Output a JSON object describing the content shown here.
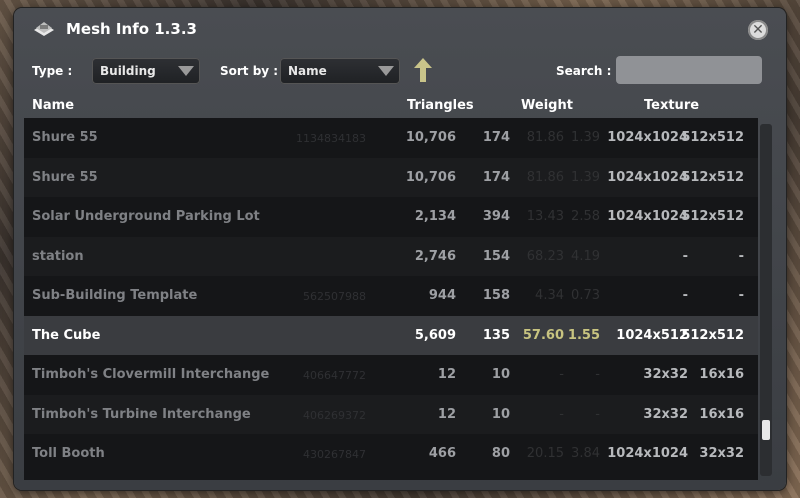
{
  "window": {
    "title": "Mesh Info 1.3.3",
    "icon": "building-icon"
  },
  "filters": {
    "type_label": "Type :",
    "type_value": "Building",
    "sortby_label": "Sort by :",
    "sortby_value": "Name",
    "sort_direction": "ascending-arrow-icon",
    "search_label": "Search :",
    "search_value": ""
  },
  "columns": {
    "name": "Name",
    "triangles": "Triangles",
    "weight": "Weight",
    "texture": "Texture"
  },
  "rows": [
    {
      "name": "Shure 55",
      "id": "1134834183",
      "triangles": "10,706",
      "mat": "174",
      "w1": "81.86",
      "w2": "1.39",
      "t1": "1024x1024",
      "t2": "512x512"
    },
    {
      "name": "Shure 55",
      "id": "",
      "triangles": "10,706",
      "mat": "174",
      "w1": "81.86",
      "w2": "1.39",
      "t1": "1024x1024",
      "t2": "512x512"
    },
    {
      "name": "Solar Underground Parking Lot",
      "id": "",
      "triangles": "2,134",
      "mat": "394",
      "w1": "13.43",
      "w2": "2.58",
      "t1": "1024x1024",
      "t2": "512x512"
    },
    {
      "name": "station",
      "id": "",
      "triangles": "2,746",
      "mat": "154",
      "w1": "68.23",
      "w2": "4.19",
      "t1": "-",
      "t2": "-"
    },
    {
      "name": "Sub-Building Template",
      "id": "562507988",
      "triangles": "944",
      "mat": "158",
      "w1": "4.34",
      "w2": "0.73",
      "t1": "-",
      "t2": "-"
    },
    {
      "name": "The Cube",
      "id": "",
      "triangles": "5,609",
      "mat": "135",
      "w1": "57.60",
      "w2": "1.55",
      "t1": "1024x512",
      "t2": "512x512"
    },
    {
      "name": "Timboh's Clovermill Interchange",
      "id": "406647772",
      "triangles": "12",
      "mat": "10",
      "w1": "-",
      "w2": "-",
      "t1": "32x32",
      "t2": "16x16"
    },
    {
      "name": "Timboh's Turbine Interchange",
      "id": "406269372",
      "triangles": "12",
      "mat": "10",
      "w1": "-",
      "w2": "-",
      "t1": "32x32",
      "t2": "16x16"
    },
    {
      "name": "Toll Booth",
      "id": "430267847",
      "triangles": "466",
      "mat": "80",
      "w1": "20.15",
      "w2": "3.84",
      "t1": "1024x1024",
      "t2": "32x32"
    }
  ],
  "selected_row": 5,
  "colors": {
    "window_bg": "#3a3d42",
    "table_bg": "#151618",
    "selected_bg": "#3a3c40",
    "weight_highlight": "#c8c480",
    "sort_arrow": "#c9c48a"
  }
}
